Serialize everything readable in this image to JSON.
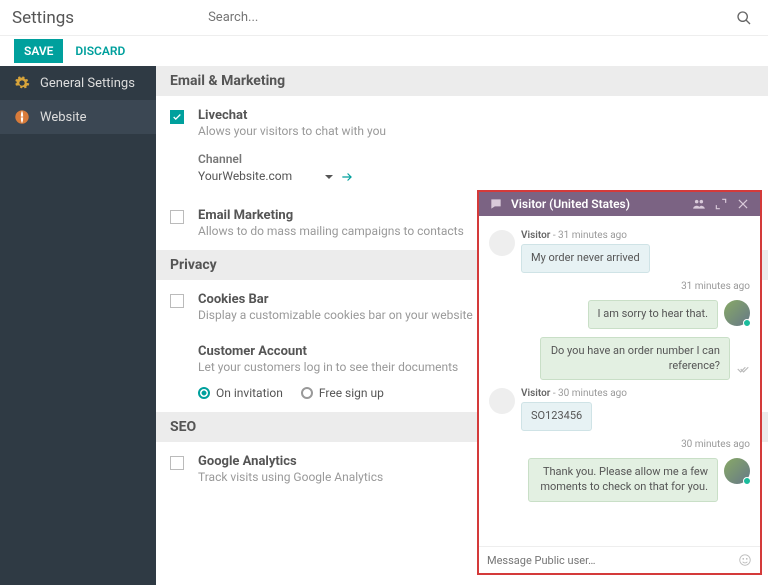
{
  "header": {
    "title": "Settings",
    "search_placeholder": "Search..."
  },
  "actions": {
    "save": "SAVE",
    "discard": "DISCARD"
  },
  "sidebar": {
    "items": [
      {
        "label": "General Settings"
      },
      {
        "label": "Website"
      }
    ]
  },
  "sections": {
    "email_marketing": {
      "title": "Email & Marketing",
      "livechat": {
        "title": "Livechat",
        "desc": "Alows your visitors to chat with you",
        "channel_label": "Channel",
        "channel_value": "YourWebsite.com"
      },
      "email_mkt": {
        "title": "Email Marketing",
        "desc": "Allows to do mass mailing campaigns to contacts"
      }
    },
    "privacy": {
      "title": "Privacy",
      "cookies": {
        "title": "Cookies Bar",
        "desc": "Display a customizable cookies bar on your website"
      },
      "customer_account": {
        "title": "Customer Account",
        "desc": "Let your customers log in to see their documents",
        "opt_invitation": "On invitation",
        "opt_free": "Free sign up"
      }
    },
    "seo": {
      "title": "SEO",
      "ga": {
        "title": "Google Analytics",
        "desc": "Track visits using Google Analytics"
      }
    }
  },
  "chat": {
    "title": "Visitor (United States)",
    "input_placeholder": "Message Public user…",
    "messages": [
      {
        "side": "left",
        "who": "Visitor",
        "time": "- 31 minutes ago",
        "text": "My order never arrived"
      },
      {
        "side": "right",
        "time": "31 minutes ago",
        "text": "I am sorry to hear that."
      },
      {
        "side": "right",
        "time": "",
        "text": "Do you have an order number I can reference?"
      },
      {
        "side": "left",
        "who": "Visitor",
        "time": "- 30 minutes ago",
        "text": "SO123456"
      },
      {
        "side": "right",
        "time": "30 minutes ago",
        "text": "Thank you. Please allow me a few moments to check on that for you."
      }
    ]
  }
}
